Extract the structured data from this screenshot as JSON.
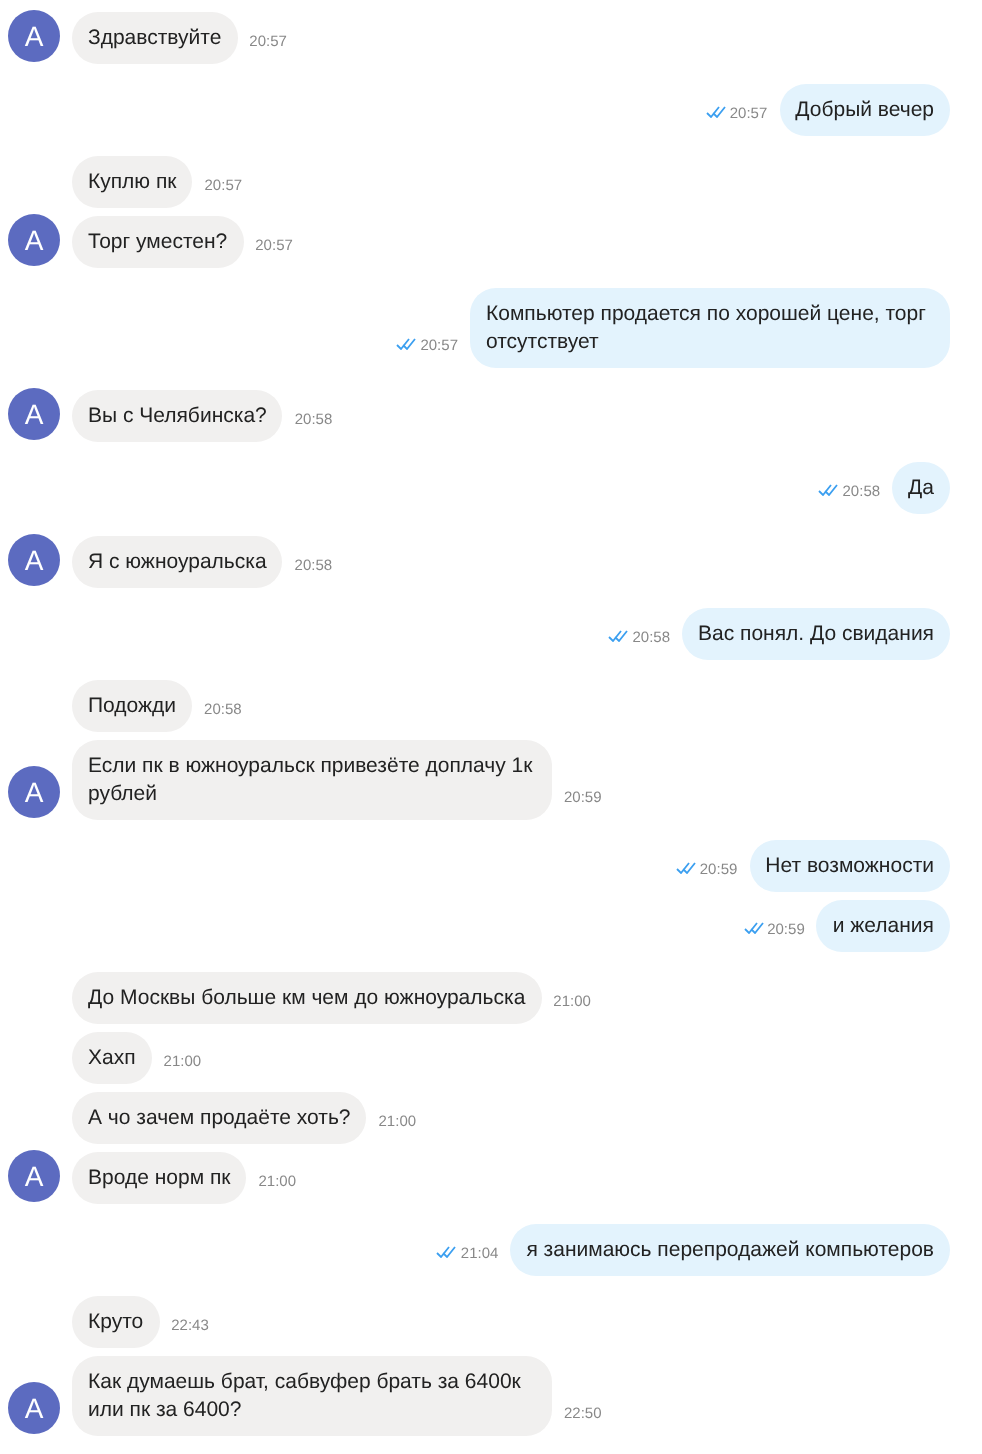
{
  "groups": [
    {
      "kind": "incoming",
      "avatar": "A",
      "messages": [
        {
          "text": "Здравствуйте",
          "time": "20:57"
        }
      ]
    },
    {
      "kind": "outgoing",
      "messages": [
        {
          "text": "Добрый вечер",
          "time": "20:57",
          "read": true
        }
      ]
    },
    {
      "kind": "incoming",
      "avatar": "A",
      "messages": [
        {
          "text": "Куплю пк",
          "time": "20:57"
        },
        {
          "text": "Торг уместен?",
          "time": "20:57"
        }
      ]
    },
    {
      "kind": "outgoing",
      "messages": [
        {
          "text": "Компьютер продается по хорошей цене, торг отсутствует",
          "time": "20:57",
          "read": true
        }
      ]
    },
    {
      "kind": "incoming",
      "avatar": "A",
      "messages": [
        {
          "text": "Вы с Челябинска?",
          "time": "20:58"
        }
      ]
    },
    {
      "kind": "outgoing",
      "messages": [
        {
          "text": "Да",
          "time": "20:58",
          "read": true
        }
      ]
    },
    {
      "kind": "incoming",
      "avatar": "A",
      "messages": [
        {
          "text": "Я с южноуральска",
          "time": "20:58"
        }
      ]
    },
    {
      "kind": "outgoing",
      "messages": [
        {
          "text": "Вас понял. До свидания",
          "time": "20:58",
          "read": true
        }
      ]
    },
    {
      "kind": "incoming",
      "avatar": "A",
      "messages": [
        {
          "text": "Подожди",
          "time": "20:58"
        },
        {
          "text": "Если пк в южноуральск привезёте доплачу 1к рублей",
          "time": "20:59"
        }
      ]
    },
    {
      "kind": "outgoing",
      "messages": [
        {
          "text": "Нет возможности",
          "time": "20:59",
          "read": true
        },
        {
          "text": "и желания",
          "time": "20:59",
          "read": true
        }
      ]
    },
    {
      "kind": "incoming",
      "avatar": "A",
      "messages": [
        {
          "text": "До Москвы больше км чем до южноуральска",
          "time": "21:00"
        },
        {
          "text": "Хахп",
          "time": "21:00"
        },
        {
          "text": "А чо зачем продаёте хоть?",
          "time": "21:00"
        },
        {
          "text": "Вроде норм пк",
          "time": "21:00"
        }
      ]
    },
    {
      "kind": "outgoing",
      "messages": [
        {
          "text": "я занимаюсь перепродажей компьютеров",
          "time": "21:04",
          "read": true
        }
      ]
    },
    {
      "kind": "incoming",
      "avatar": "A",
      "messages": [
        {
          "text": "Круто",
          "time": "22:43"
        },
        {
          "text": "Как думаешь брат, сабвуфер брать за 6400к или пк за 6400?",
          "time": "22:50"
        }
      ]
    }
  ]
}
